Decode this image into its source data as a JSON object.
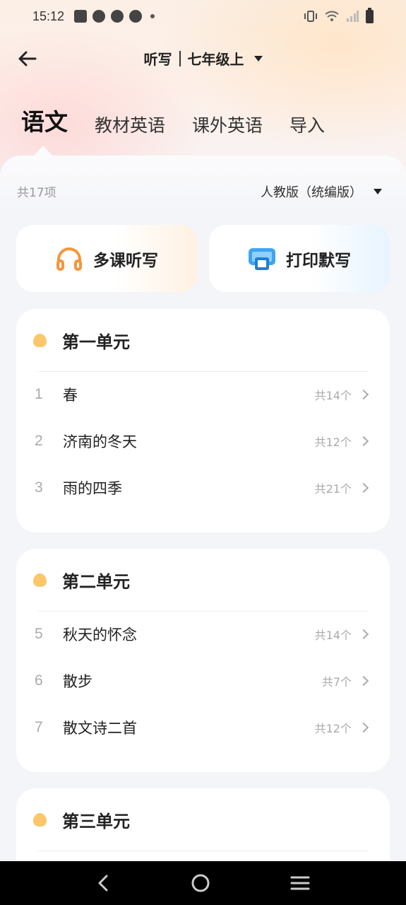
{
  "status_bar": {
    "time": "15:12"
  },
  "header": {
    "back_icon": "arrow-left-icon",
    "title": "听写",
    "grade": "七年级上"
  },
  "tabs": [
    {
      "label": "语文",
      "active": true
    },
    {
      "label": "教材英语",
      "active": false
    },
    {
      "label": "课外英语",
      "active": false
    },
    {
      "label": "导入",
      "active": false
    }
  ],
  "summary": {
    "count": "共17项",
    "edition": "人教版（统编版）"
  },
  "actions": {
    "multi_dictation": {
      "label": "多课听写",
      "icon": "headphones-icon"
    },
    "print_dictation": {
      "label": "打印默写",
      "icon": "printer-icon"
    }
  },
  "units": [
    {
      "title": "第一单元",
      "lessons": [
        {
          "num": "1",
          "name": "春",
          "count": "共14个"
        },
        {
          "num": "2",
          "name": "济南的冬天",
          "count": "共12个"
        },
        {
          "num": "3",
          "name": "雨的四季",
          "count": "共21个"
        }
      ]
    },
    {
      "title": "第二单元",
      "lessons": [
        {
          "num": "5",
          "name": "秋天的怀念",
          "count": "共14个"
        },
        {
          "num": "6",
          "name": "散步",
          "count": "共7个"
        },
        {
          "num": "7",
          "name": "散文诗二首",
          "count": "共12个"
        }
      ]
    },
    {
      "title": "第三单元",
      "lessons": []
    }
  ],
  "colors": {
    "unit_dot": "#fbc76a",
    "headphones": "#f5953b",
    "printer": "#3fa4f0"
  }
}
